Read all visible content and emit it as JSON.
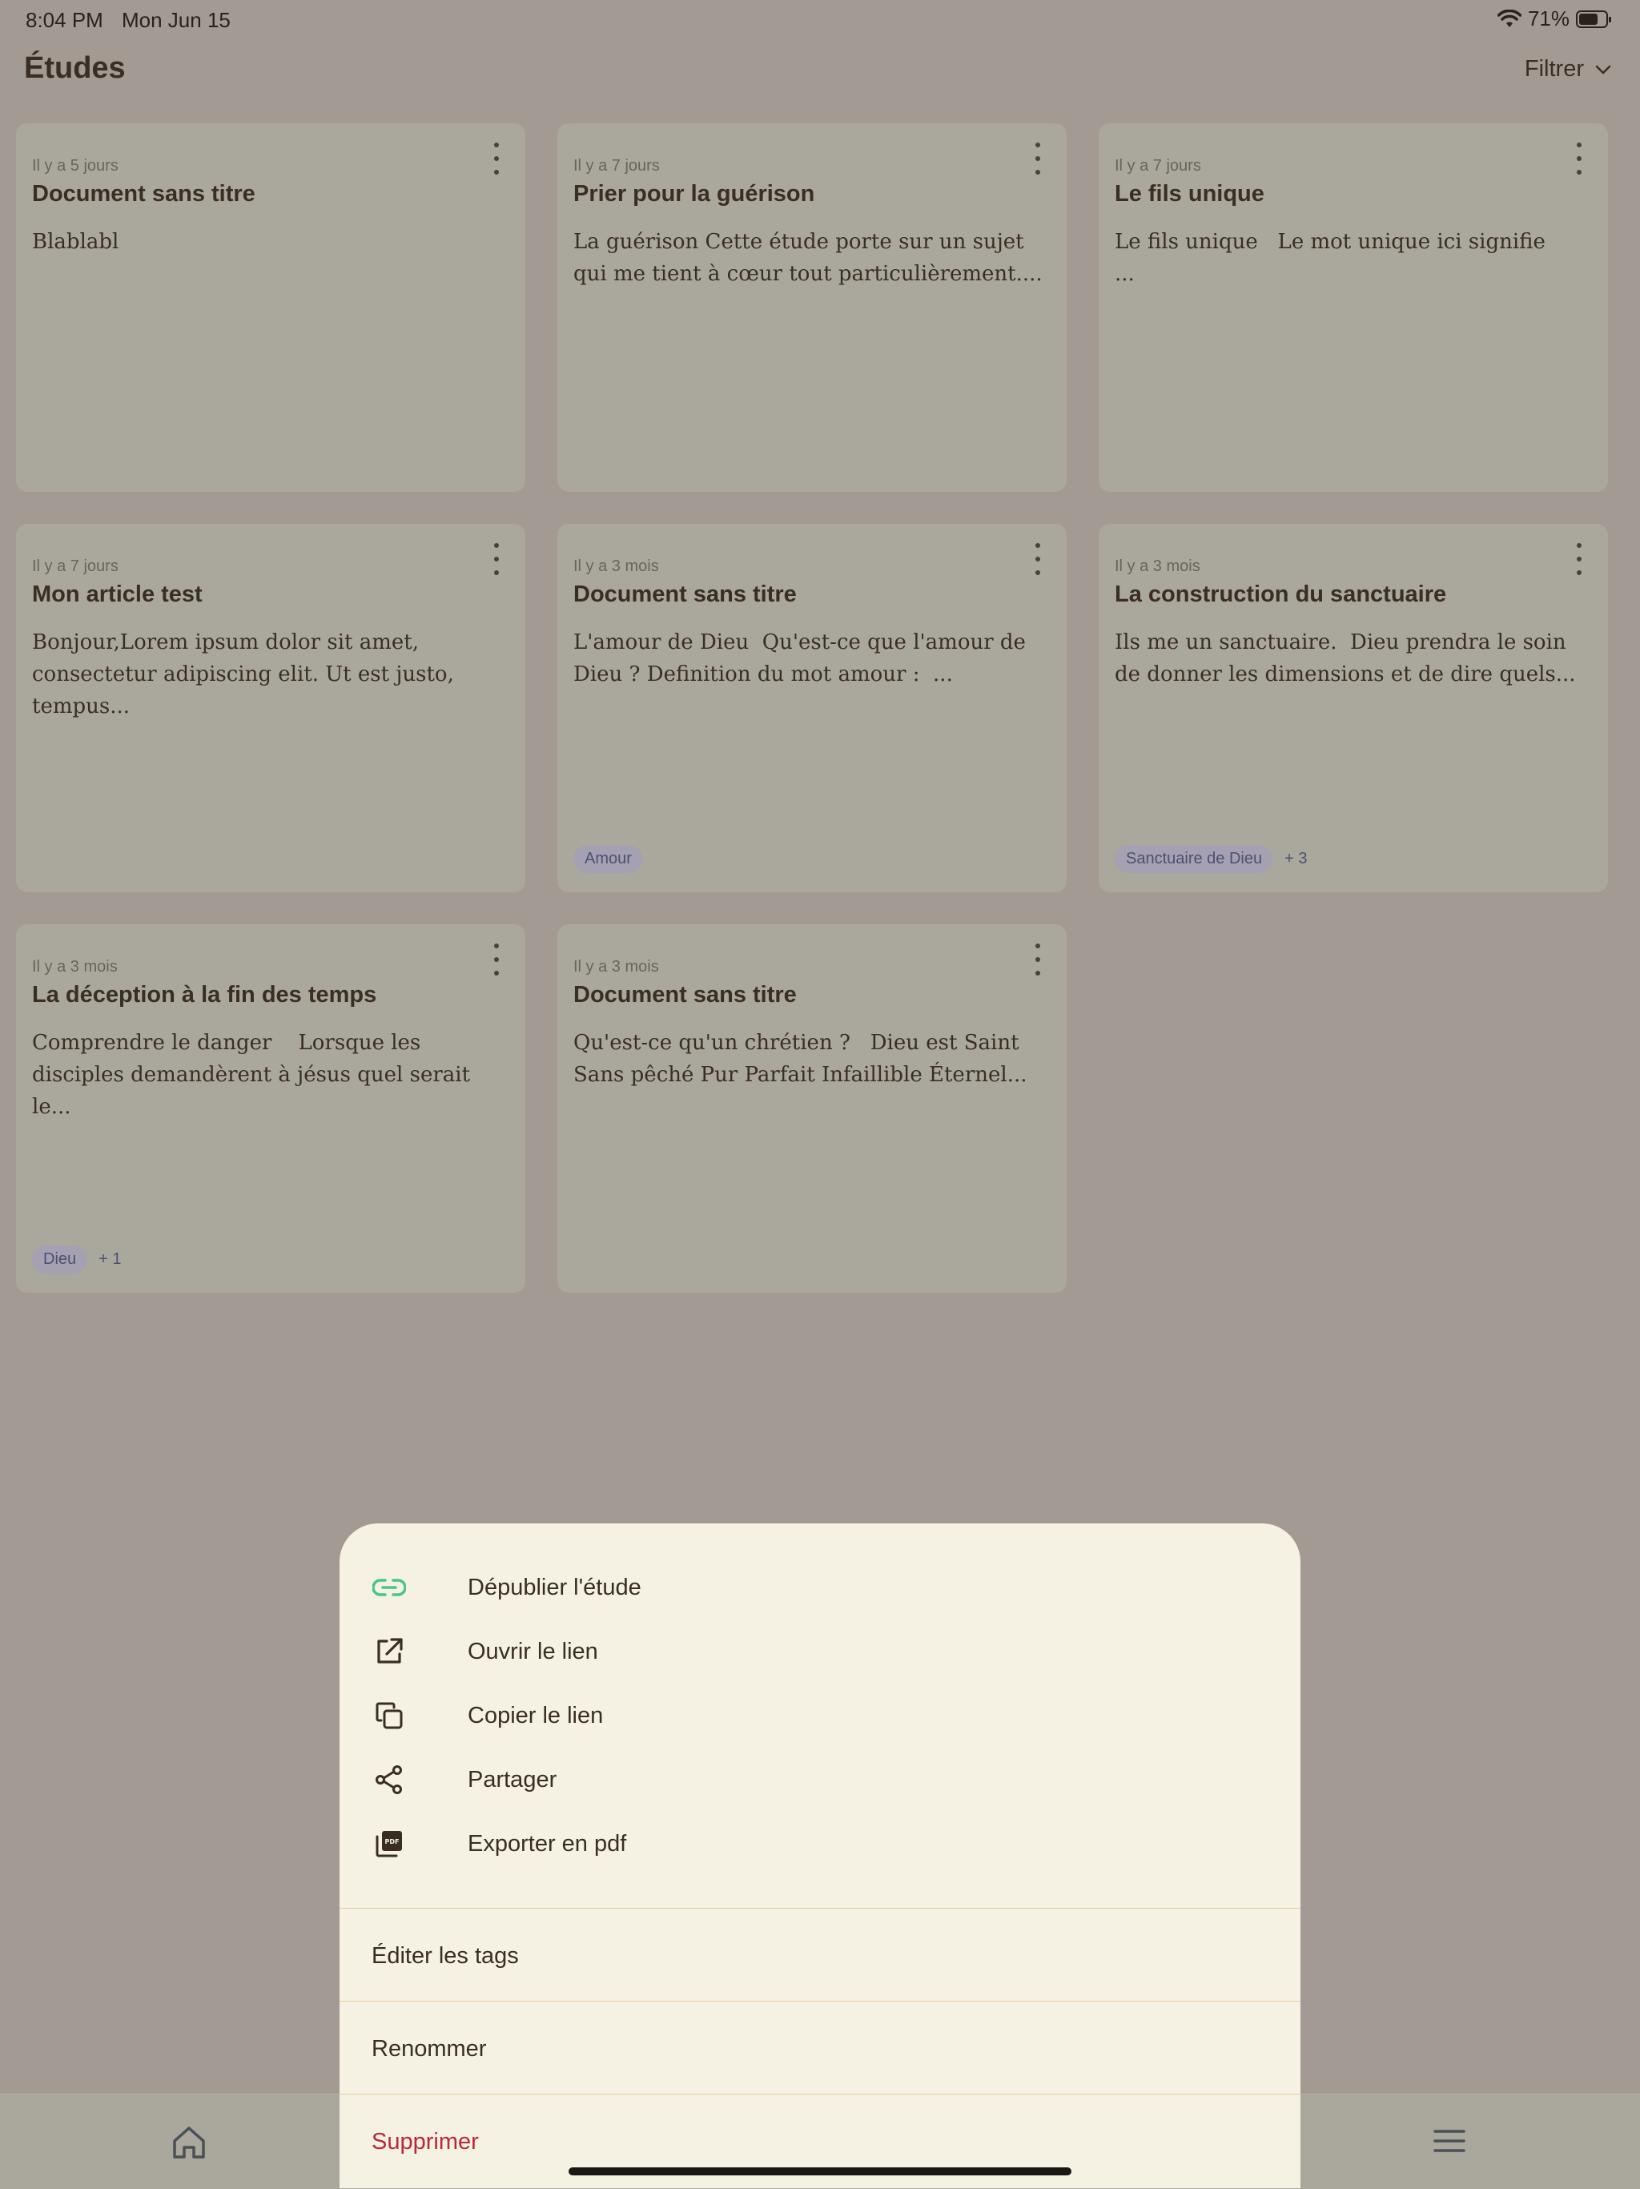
{
  "status_bar": {
    "time": "8:04 PM",
    "date": "Mon Jun 15",
    "battery": "71%",
    "battery_level": 0.71,
    "wifi_icon": "wifi-icon",
    "battery_icon": "battery-icon"
  },
  "header": {
    "title": "Études",
    "filter_label": "Filtrer"
  },
  "cards": [
    {
      "date": "Il y a 5 jours",
      "title": "Document sans titre",
      "excerpt": "Blablabl",
      "tags": [],
      "more": ""
    },
    {
      "date": "Il y a 7 jours",
      "title": "Prier pour la guérison",
      "excerpt": "La guérison Cette étude porte sur un sujet qui me tient à cœur tout particulièrement....",
      "tags": [],
      "more": ""
    },
    {
      "date": "Il y a 7 jours",
      "title": "Le fils unique",
      "excerpt": "Le fils unique   Le mot unique ici signifie     ...",
      "tags": [],
      "more": ""
    },
    {
      "date": "Il y a 7 jours",
      "title": "Mon article test",
      "excerpt": "Bonjour,Lorem ipsum dolor sit amet, consectetur adipiscing elit. Ut est justo, tempus...",
      "tags": [],
      "more": ""
    },
    {
      "date": "Il y a 3 mois",
      "title": "Document sans titre",
      "excerpt": "L'amour de Dieu  Qu'est-ce que l'amour de Dieu ? Definition du mot amour :  ...",
      "tags": [
        "Amour"
      ],
      "more": ""
    },
    {
      "date": "Il y a 3 mois",
      "title": "La construction du sanctuaire",
      "excerpt": "Ils me un sanctuaire.  Dieu prendra le soin de donner les dimensions et de dire quels...",
      "tags": [
        "Sanctuaire de Dieu"
      ],
      "more": "+ 3"
    },
    {
      "date": "Il y a 3 mois",
      "title": "La déception à la fin des temps",
      "excerpt": "Comprendre le danger    Lorsque les disciples demandèrent à jésus quel serait le...",
      "tags": [
        "Dieu"
      ],
      "more": "+ 1"
    },
    {
      "date": "Il y a 3 mois",
      "title": "Document sans titre",
      "excerpt": "Qu'est-ce qu'un chrétien ?   Dieu est Saint Sans pêché Pur Parfait Infaillible Éternel...",
      "tags": [],
      "more": ""
    }
  ],
  "sheet": {
    "actions": [
      {
        "label": "Dépublier l'étude",
        "icon": "link-icon"
      },
      {
        "label": "Ouvrir le lien",
        "icon": "external-link-icon"
      },
      {
        "label": "Copier le lien",
        "icon": "copy-icon"
      },
      {
        "label": "Partager",
        "icon": "share-icon"
      },
      {
        "label": "Exporter en pdf",
        "icon": "pdf-icon"
      }
    ],
    "edit_tags": "Éditer les tags",
    "rename": "Renommer",
    "delete": "Supprimer"
  },
  "bottom_nav": {
    "home_icon": "home-icon",
    "menu_icon": "hamburger-menu-icon"
  },
  "colors": {
    "accent_green": "#4cc38a",
    "danger": "#b9293c",
    "tag_bg": "#a5a1b2"
  }
}
